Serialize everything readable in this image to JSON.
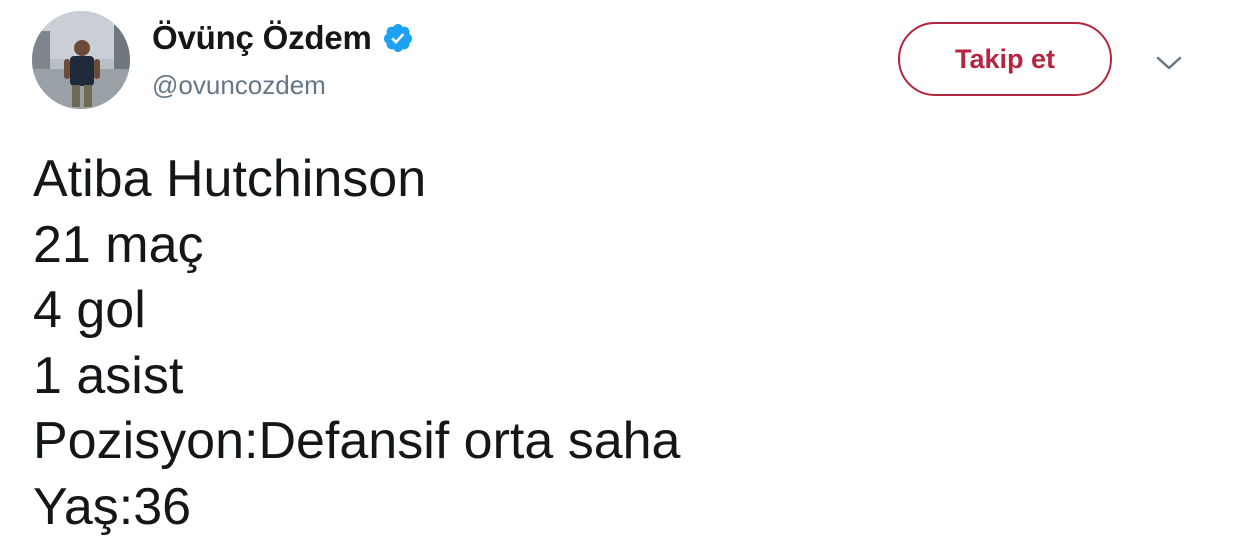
{
  "author": {
    "display_name": "Övünç Özdem",
    "handle": "@ovuncozdem",
    "verified": true,
    "avatar_icon": "profile-photo"
  },
  "actions": {
    "follow_label": "Takip et",
    "menu_icon": "chevron-down-icon"
  },
  "tweet": {
    "lines": [
      "Atiba Hutchinson",
      "21 maç",
      "4 gol",
      "1 asist",
      "Pozisyon:Defansif orta saha",
      "Yaş:36"
    ]
  },
  "colors": {
    "follow_accent": "#b5263f",
    "verified_blue": "#1da1f2",
    "handle_gray": "#657786",
    "text": "#14171a"
  }
}
